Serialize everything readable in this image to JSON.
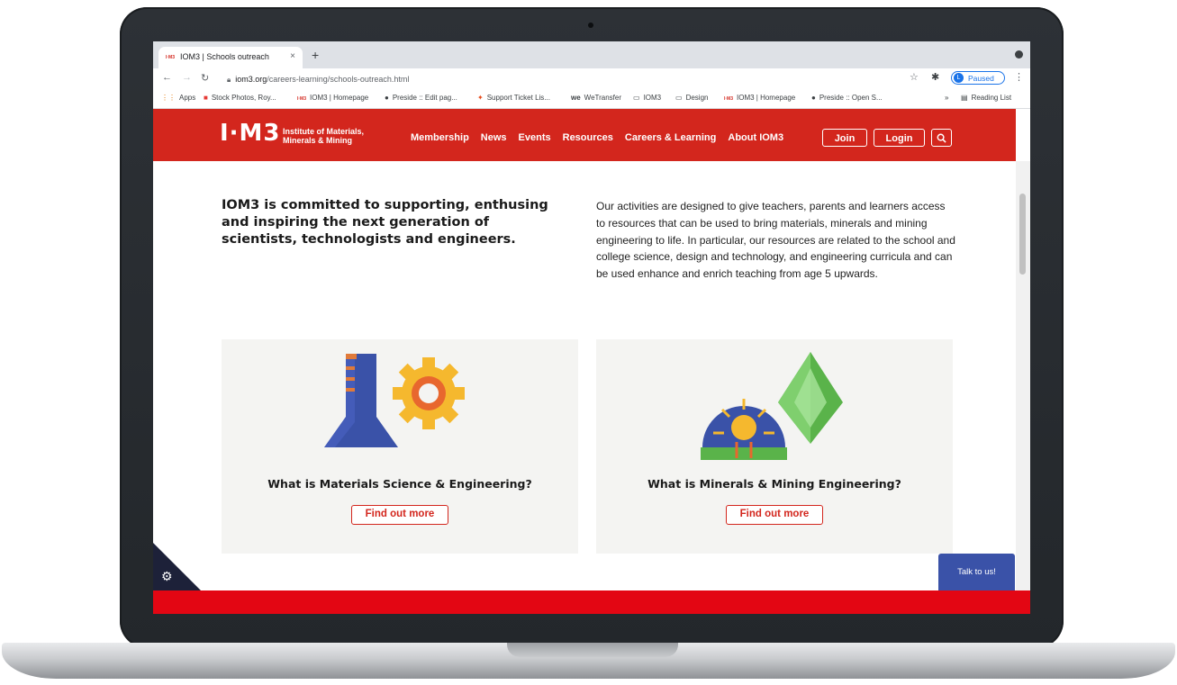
{
  "browser": {
    "tab_title": "IOM3 | Schools outreach",
    "tab_favicon_text": "I·M3",
    "new_tab": "+",
    "close_tab": "×",
    "url_domain": "iom3.org",
    "url_path": "/careers-learning/schools-outreach.html",
    "profile_initial": "L",
    "profile_status": "Paused",
    "bookmarks": [
      {
        "icon": "apps-grid-icon",
        "glyph": "⋮⋮",
        "label": "Apps"
      },
      {
        "icon": "stock-photo-icon",
        "glyph": "■",
        "label": "Stock Photos, Roy..."
      },
      {
        "icon": "iom3-favicon-icon",
        "glyph": "I·M3",
        "label": "IOM3 | Homepage"
      },
      {
        "icon": "preside-icon",
        "glyph": "●",
        "label": "Preside :: Edit pag..."
      },
      {
        "icon": "support-icon",
        "glyph": "✦",
        "label": "Support Ticket Lis..."
      },
      {
        "icon": "wetransfer-icon",
        "glyph": "we",
        "label": "WeTransfer"
      },
      {
        "icon": "folder-icon",
        "glyph": "▭",
        "label": "IOM3"
      },
      {
        "icon": "folder-icon",
        "glyph": "▭",
        "label": "Design"
      },
      {
        "icon": "iom3-favicon-icon",
        "glyph": "I·M3",
        "label": "IOM3 | Homepage"
      },
      {
        "icon": "preside-icon",
        "glyph": "●",
        "label": "Preside :: Open S..."
      }
    ],
    "overflow": "»",
    "reading_list": "Reading List"
  },
  "site": {
    "logo": "I·M3",
    "logo_line1": "Institute of Materials,",
    "logo_line2": "Minerals & Mining",
    "nav": [
      "Membership",
      "News",
      "Events",
      "Resources",
      "Careers & Learning",
      "About IOM3"
    ],
    "join": "Join",
    "login": "Login"
  },
  "content": {
    "lead": "IOM3 is committed to supporting, enthusing and inspiring the next generation of scientists, technologists and engineers.",
    "intro": "Our activities are designed to give teachers, parents and learners access to resources that can be used to bring materials, minerals and mining engineering to life. In particular, our resources are related to the school and college science, design and technology, and engineering curricula and can be used enhance and enrich teaching from age 5 upwards.",
    "cards": [
      {
        "title": "What is Materials Science & Engineering?",
        "button": "Find out more"
      },
      {
        "title": "What is Minerals & Mining Engineering?",
        "button": "Find out more"
      }
    ]
  },
  "widgets": {
    "talk": "Talk to us!"
  },
  "colors": {
    "brand_red": "#d3261d",
    "footer_red": "#e30613",
    "chat_blue": "#3a52a8",
    "cookie_navy": "#1d2139"
  }
}
